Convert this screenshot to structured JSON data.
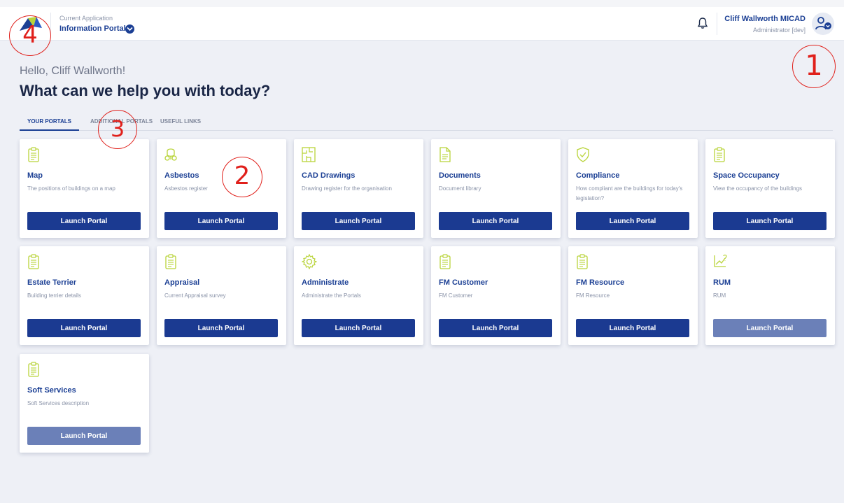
{
  "header": {
    "app_caption": "Current Application",
    "app_name": "Information Portal",
    "user_name": "Cliff Wallworth MICAD",
    "user_role": "Administrator [dev]"
  },
  "main": {
    "greeting": "Hello, Cliff Wallworth!",
    "headline": "What can we help you with today?"
  },
  "tabs": [
    {
      "label": "YOUR PORTALS",
      "active": true
    },
    {
      "label": "ADDITIONAL PORTALS",
      "active": false
    },
    {
      "label": "USEFUL LINKS",
      "active": false
    }
  ],
  "portals": [
    {
      "title": "Map",
      "desc": "The positions of buildings on a map",
      "icon": "clipboard-icon",
      "button": "Launch Portal"
    },
    {
      "title": "Asbestos",
      "desc": "Asbestos register",
      "icon": "respirator-icon",
      "button": "Launch Portal"
    },
    {
      "title": "CAD Drawings",
      "desc": "Drawing register for the organisation",
      "icon": "floorplan-icon",
      "button": "Launch Portal"
    },
    {
      "title": "Documents",
      "desc": "Document library",
      "icon": "document-icon",
      "button": "Launch Portal"
    },
    {
      "title": "Compliance",
      "desc": "How compliant are the buildings for today's legislation?",
      "icon": "shield-check-icon",
      "button": "Launch Portal"
    },
    {
      "title": "Space Occupancy",
      "desc": "View the occupancy of the buildings",
      "icon": "clipboard-icon",
      "button": "Launch Portal"
    },
    {
      "title": "Estate Terrier",
      "desc": "Building terrier details",
      "icon": "clipboard-icon",
      "button": "Launch Portal"
    },
    {
      "title": "Appraisal",
      "desc": "Current Appraisal survey",
      "icon": "clipboard-icon",
      "button": "Launch Portal"
    },
    {
      "title": "Administrate",
      "desc": "Administrate the Portals",
      "icon": "gear-icon",
      "button": "Launch Portal"
    },
    {
      "title": "FM Customer",
      "desc": "FM Customer",
      "icon": "clipboard-icon",
      "button": "Launch Portal"
    },
    {
      "title": "FM Resource",
      "desc": "FM Resource",
      "icon": "clipboard-icon",
      "button": "Launch Portal"
    },
    {
      "title": "RUM",
      "desc": "RUM",
      "icon": "chart-icon",
      "button": "Launch Portal"
    },
    {
      "title": "Soft Services",
      "desc": "Soft Services description",
      "icon": "clipboard-icon",
      "button": "Launch Portal"
    }
  ],
  "annotations": [
    "1",
    "2",
    "3",
    "4"
  ],
  "colors": {
    "brand_blue": "#1b3f94",
    "button_blue": "#1b3a91",
    "button_disabled": "#6b80b8",
    "icon_green": "#b9d43a",
    "annotation_red": "#e0201b"
  }
}
